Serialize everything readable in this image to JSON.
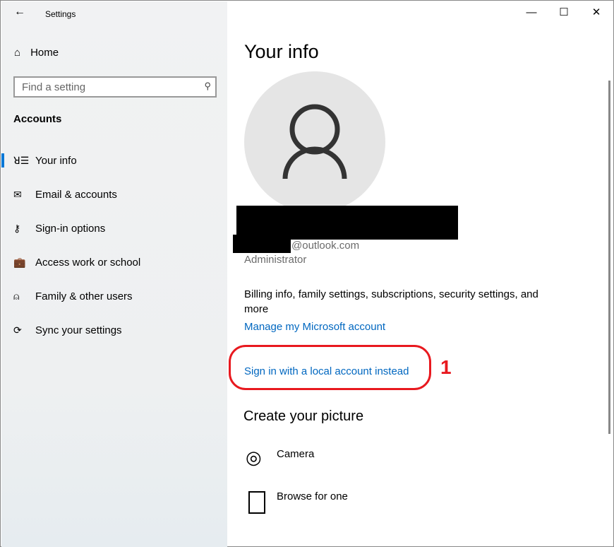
{
  "window": {
    "title": "Settings",
    "back": "←",
    "minimize": "—",
    "maximize": "☐",
    "close": "✕"
  },
  "sidebar": {
    "home": "Home",
    "search_placeholder": "Find a setting",
    "section": "Accounts",
    "items": [
      {
        "label": "Your info",
        "icon": "ꓤ☰"
      },
      {
        "label": "Email & accounts",
        "icon": "✉"
      },
      {
        "label": "Sign-in options",
        "icon": "⚷"
      },
      {
        "label": "Access work or school",
        "icon": "💼"
      },
      {
        "label": "Family & other users",
        "icon": "⍝"
      },
      {
        "label": "Sync your settings",
        "icon": "⟳"
      }
    ]
  },
  "main": {
    "title": "Your info",
    "email_suffix": "@outlook.com",
    "role": "Administrator",
    "billing": "Billing info, family settings, subscriptions, security settings, and more",
    "manage_link": "Manage my Microsoft account",
    "local_link": "Sign in with a local account instead",
    "annotation": "1",
    "picture_heading": "Create your picture",
    "camera": "Camera",
    "browse": "Browse for one"
  },
  "colors": {
    "accent": "#0078d7",
    "annotation": "#e8191f"
  }
}
